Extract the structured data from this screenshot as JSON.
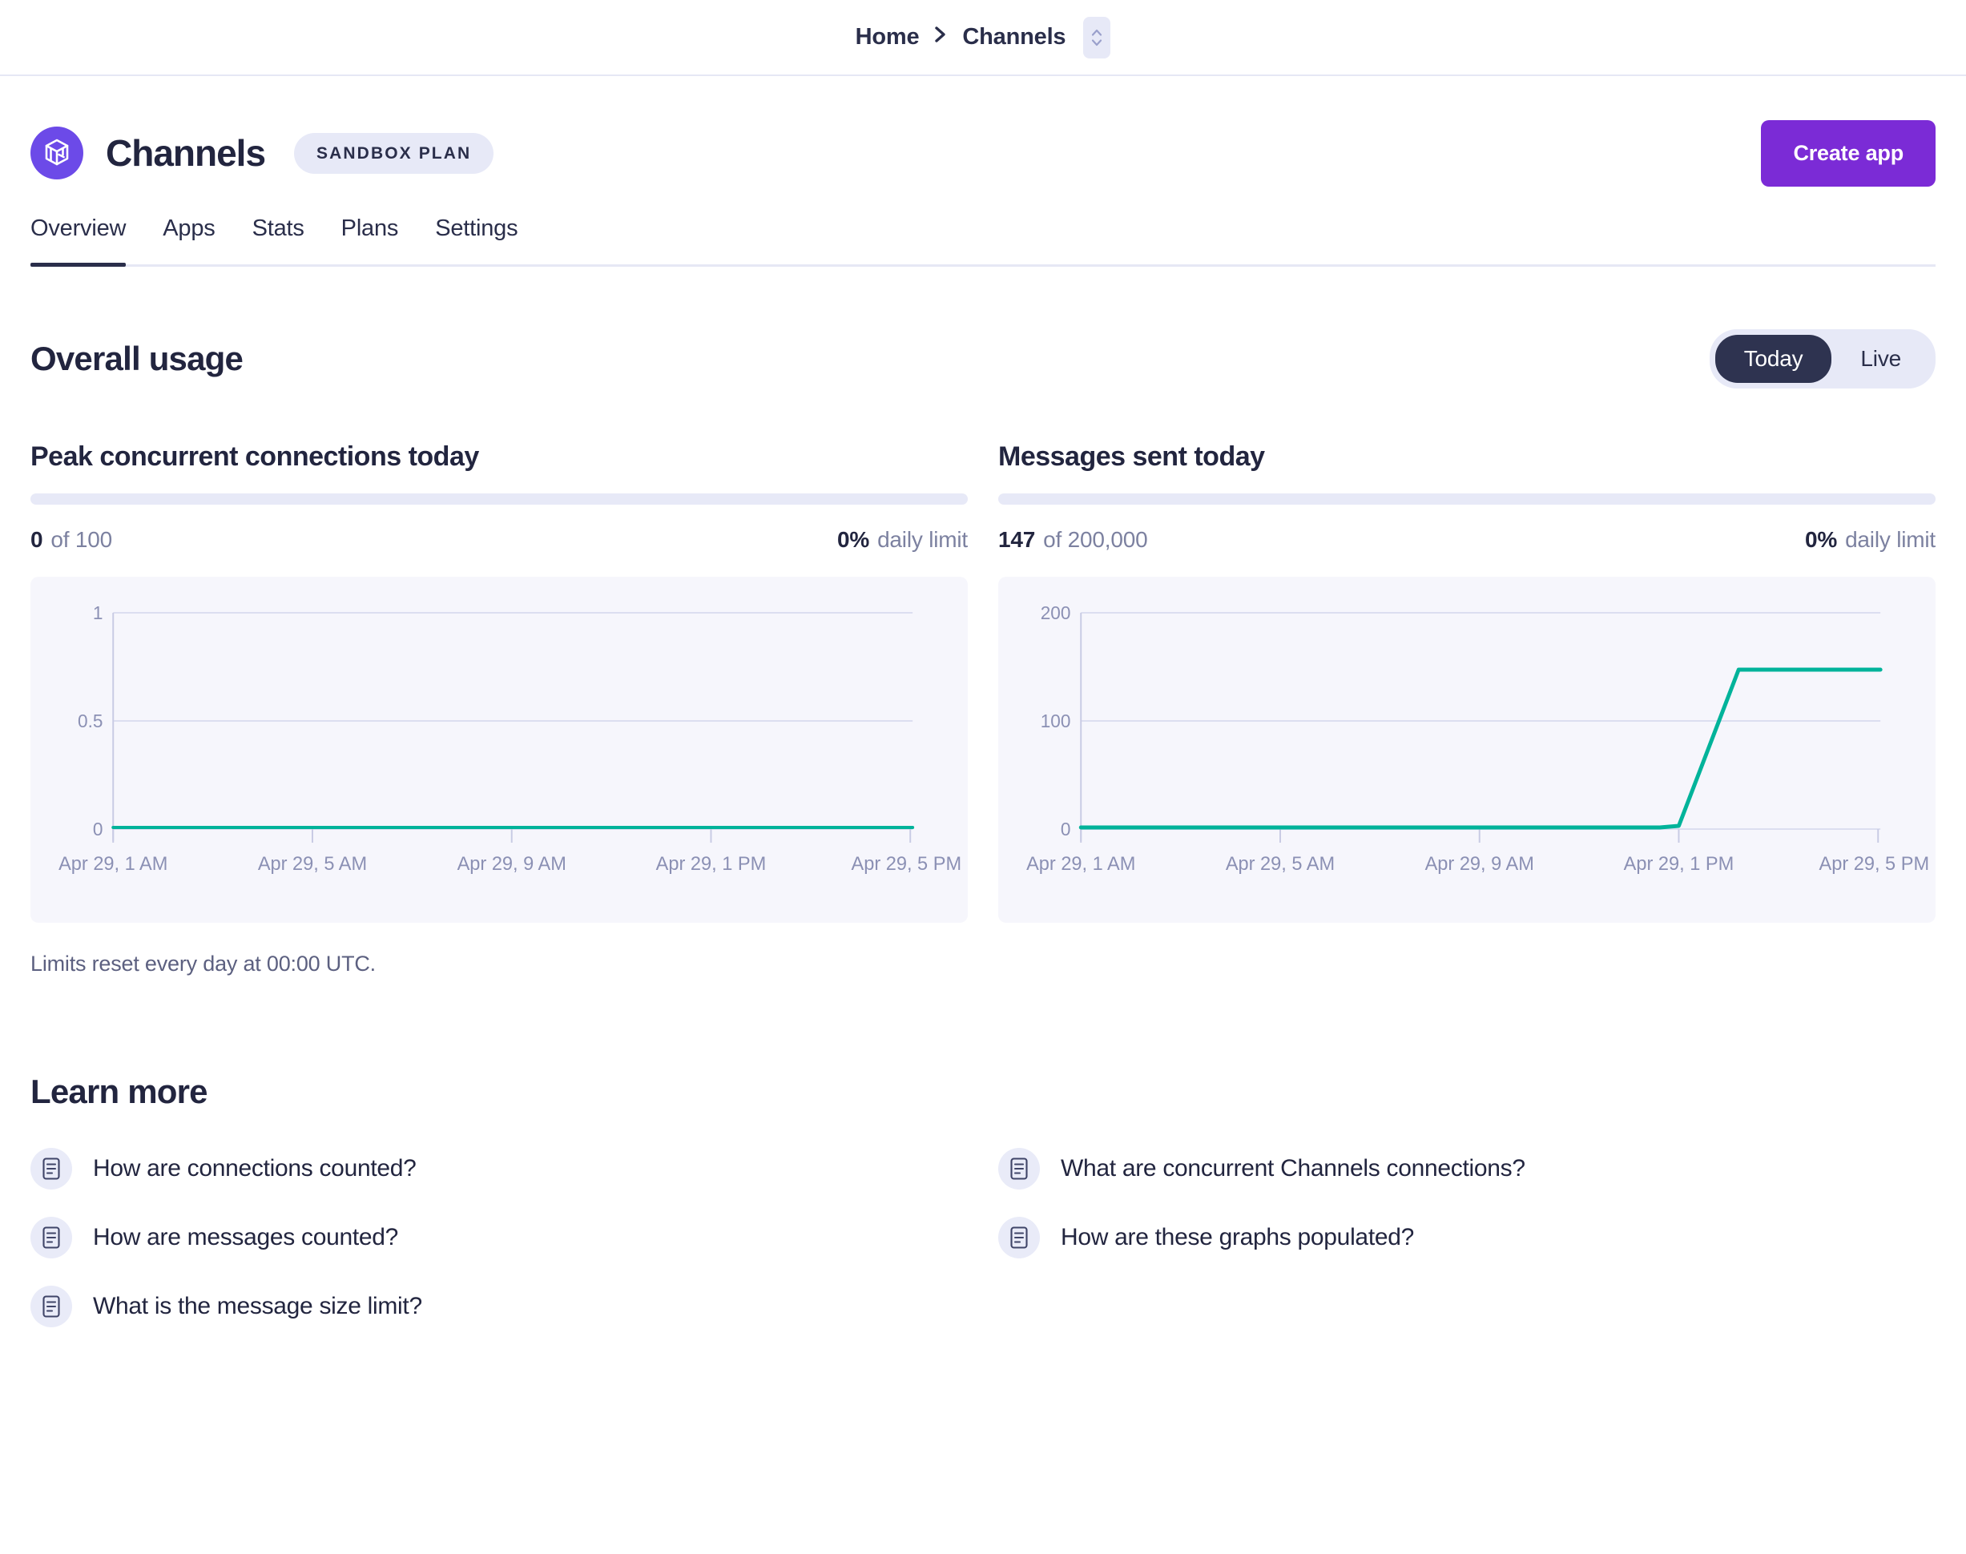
{
  "breadcrumb": {
    "home_label": "Home",
    "separator": "›",
    "current_label": "Channels"
  },
  "header": {
    "app_name": "Channels",
    "plan_badge": "SANDBOX PLAN",
    "create_app_label": "Create app",
    "brand_color": "#6c4ae8",
    "cta_color": "#7b2bd6"
  },
  "tabs": [
    {
      "label": "Overview",
      "active": true
    },
    {
      "label": "Apps",
      "active": false
    },
    {
      "label": "Stats",
      "active": false
    },
    {
      "label": "Plans",
      "active": false
    },
    {
      "label": "Settings",
      "active": false
    }
  ],
  "overall_usage": {
    "title": "Overall usage",
    "range_options": [
      {
        "label": "Today",
        "selected": true
      },
      {
        "label": "Live",
        "selected": false
      }
    ],
    "limits_note": "Limits reset every day at 00:00 UTC."
  },
  "cards": {
    "connections": {
      "title": "Peak concurrent connections today",
      "value": "0",
      "of_text": "of 100",
      "percent": "0%",
      "percent_suffix": "daily limit",
      "progress_percent": 0
    },
    "messages": {
      "title": "Messages sent today",
      "value": "147",
      "of_text": "of 200,000",
      "percent": "0%",
      "percent_suffix": "daily limit",
      "progress_percent": 0
    }
  },
  "learn_more": {
    "title": "Learn more",
    "left_items": [
      {
        "label": "How are connections counted?",
        "icon": "document-icon"
      },
      {
        "label": "How are messages counted?",
        "icon": "document-icon"
      },
      {
        "label": "What is the message size limit?",
        "icon": "document-icon"
      }
    ],
    "right_items": [
      {
        "label": "What are concurrent Channels connections?",
        "icon": "document-icon"
      },
      {
        "label": "How are these graphs populated?",
        "icon": "document-icon"
      }
    ]
  },
  "chart_data": [
    {
      "type": "line",
      "title": "Peak concurrent connections today",
      "xlabel": "",
      "ylabel": "",
      "x": [
        "Apr 29, 1 AM",
        "Apr 29, 5 AM",
        "Apr 29, 9 AM",
        "Apr 29, 1 PM",
        "Apr 29, 5 PM"
      ],
      "xtick_labels": [
        "Apr 29, 1 AM",
        "Apr 29, 5 AM",
        "Apr 29, 9 AM",
        "Apr 29, 1 PM",
        "Apr 29, 5 PM"
      ],
      "ytick_labels": [
        "0",
        "0.5",
        "1"
      ],
      "ylim": [
        0,
        1
      ],
      "grid": true,
      "legend": "none",
      "line_color": "#00b39a",
      "series": [
        {
          "name": "Peak concurrent connections",
          "values": [
            0,
            0,
            0,
            0,
            0
          ]
        }
      ]
    },
    {
      "type": "line",
      "title": "Messages sent today",
      "xlabel": "",
      "ylabel": "",
      "x": [
        "Apr 29, 1 AM",
        "Apr 29, 5 AM",
        "Apr 29, 9 AM",
        "Apr 29, 1 PM",
        "Apr 29, 5 PM"
      ],
      "xtick_labels": [
        "Apr 29, 1 AM",
        "Apr 29, 5 AM",
        "Apr 29, 9 AM",
        "Apr 29, 1 PM",
        "Apr 29, 5 PM"
      ],
      "ytick_labels": [
        "0",
        "100",
        "200"
      ],
      "ylim": [
        0,
        200
      ],
      "grid": true,
      "legend": "none",
      "line_color": "#00b39a",
      "series": [
        {
          "name": "Messages sent",
          "values": [
            0,
            0,
            0,
            0,
            147,
            147,
            147
          ]
        }
      ],
      "annotations": [
        "Flat at 0 from 1 AM until ~1 PM, rises sharply to 147 by ~2 PM, then flat at 147 through 6 PM"
      ]
    }
  ]
}
